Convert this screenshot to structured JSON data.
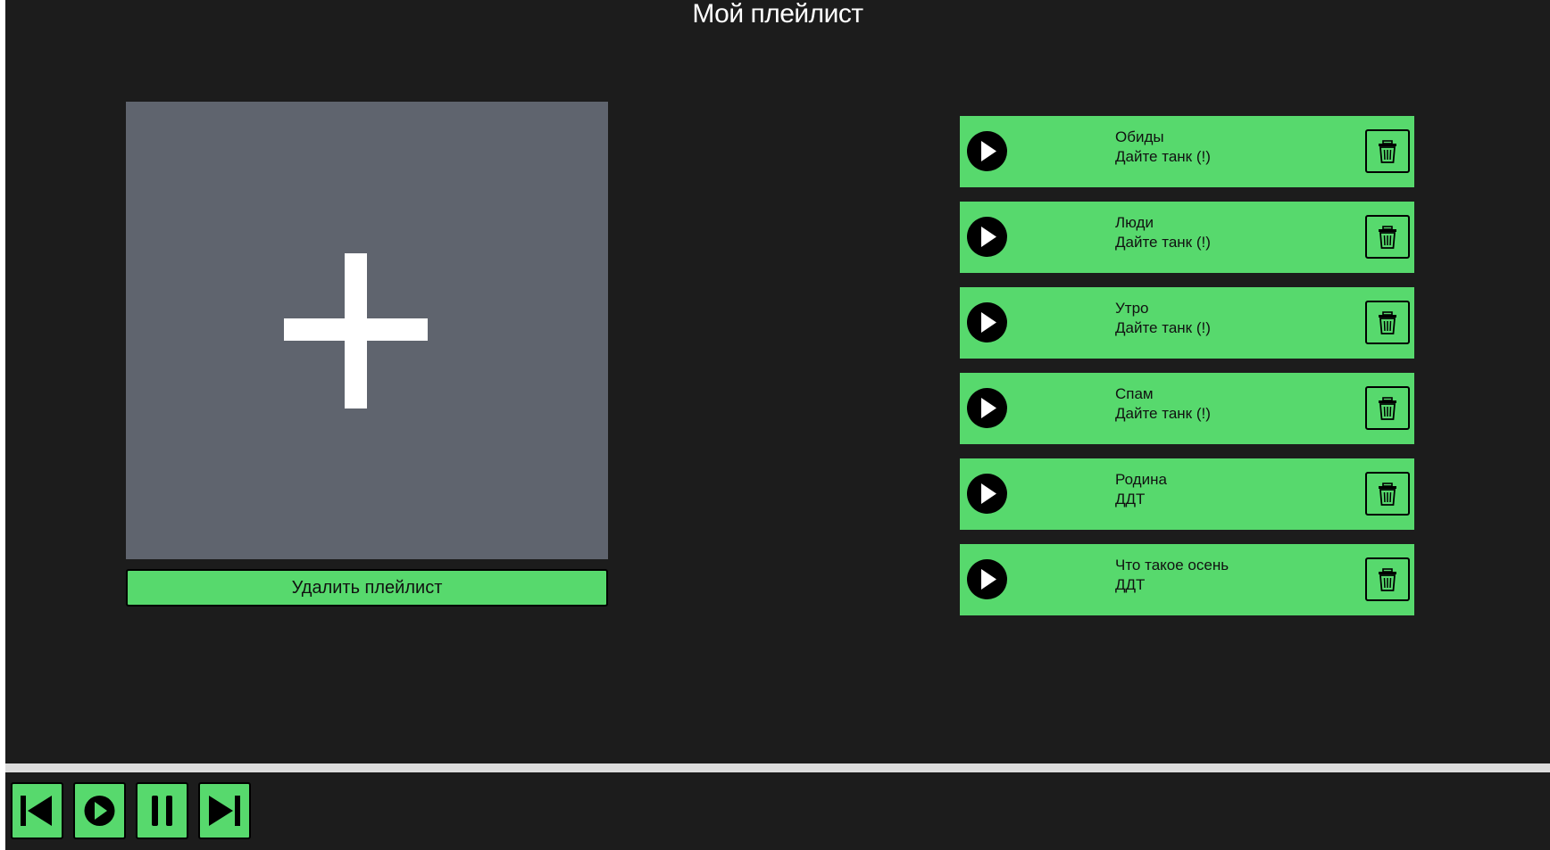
{
  "page": {
    "title": "Мой плейлист"
  },
  "playlist_cover": {
    "icon": "plus-icon"
  },
  "delete_playlist_label": "Удалить плейлист",
  "tracks": [
    {
      "title": "Обиды",
      "artist": "Дайте танк (!)"
    },
    {
      "title": "Люди",
      "artist": "Дайте танк (!)"
    },
    {
      "title": "Утро",
      "artist": "Дайте танк (!)"
    },
    {
      "title": "Спам",
      "artist": "Дайте танк (!)"
    },
    {
      "title": "Родина",
      "artist": "ДДТ"
    },
    {
      "title": "Что такое осень",
      "artist": "ДДТ"
    }
  ],
  "player": {
    "controls": [
      "skip-previous-icon",
      "play-icon",
      "pause-icon",
      "skip-next-icon"
    ]
  },
  "colors": {
    "background": "#1c1c1c",
    "accent": "#57d96d",
    "cover": "#5f646e",
    "progress_track": "#dcdcdc"
  }
}
